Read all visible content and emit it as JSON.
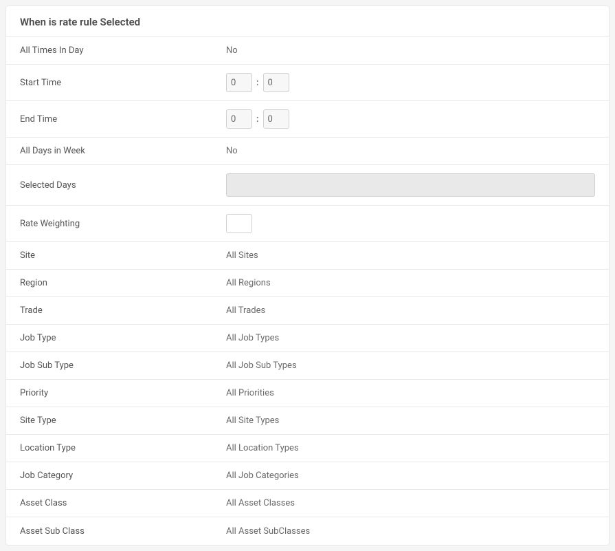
{
  "panel": {
    "title": "When is rate rule Selected"
  },
  "rows": {
    "allTimesInDay": {
      "label": "All Times In Day",
      "value": "No"
    },
    "startTime": {
      "label": "Start Time",
      "hour": "0",
      "minute": "0"
    },
    "endTime": {
      "label": "End Time",
      "hour": "0",
      "minute": "0"
    },
    "allDaysInWeek": {
      "label": "All Days in Week",
      "value": "No"
    },
    "selectedDays": {
      "label": "Selected Days",
      "value": ""
    },
    "rateWeighting": {
      "label": "Rate Weighting",
      "value": ""
    },
    "site": {
      "label": "Site",
      "value": "All Sites"
    },
    "region": {
      "label": "Region",
      "value": "All Regions"
    },
    "trade": {
      "label": "Trade",
      "value": "All Trades"
    },
    "jobType": {
      "label": "Job Type",
      "value": "All Job Types"
    },
    "jobSubType": {
      "label": "Job Sub Type",
      "value": "All Job Sub Types"
    },
    "priority": {
      "label": "Priority",
      "value": "All Priorities"
    },
    "siteType": {
      "label": "Site Type",
      "value": "All Site Types"
    },
    "locationType": {
      "label": "Location Type",
      "value": "All Location Types"
    },
    "jobCategory": {
      "label": "Job Category",
      "value": "All Job Categories"
    },
    "assetClass": {
      "label": "Asset Class",
      "value": "All Asset Classes"
    },
    "assetSubClass": {
      "label": "Asset Sub Class",
      "value": "All Asset SubClasses"
    }
  }
}
